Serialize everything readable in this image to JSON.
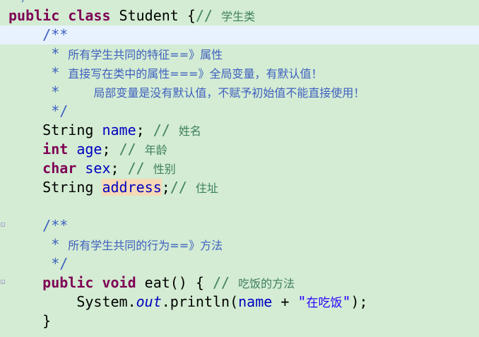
{
  "editor": {
    "lines": [
      {
        "parts": [
          "public",
          " ",
          "class",
          " Student {",
          "// ",
          "学生类"
        ]
      },
      {
        "parts": [
          "    ",
          "/**"
        ]
      },
      {
        "parts": [
          "     * ",
          "所有学生共同的特征==》属性"
        ]
      },
      {
        "parts": [
          "     * ",
          "直接写在类中的属性===》全局变量，有默认值！"
        ]
      },
      {
        "parts": [
          "     *    ",
          "局部变量是没有默认值，不赋予初始值不能直接使用！"
        ]
      },
      {
        "parts": [
          "     */"
        ]
      },
      {
        "parts": [
          "    String ",
          "name",
          "; ",
          "// ",
          "姓名"
        ]
      },
      {
        "parts": [
          "    ",
          "int",
          " ",
          "age",
          "; ",
          "// ",
          "年龄"
        ]
      },
      {
        "parts": [
          "    ",
          "char",
          " ",
          "sex",
          "; ",
          "// ",
          "性别"
        ]
      },
      {
        "parts": [
          "    String ",
          "address",
          ";",
          "// ",
          "住址"
        ]
      },
      {
        "parts": [
          ""
        ]
      },
      {
        "parts": [
          "    ",
          "/**"
        ]
      },
      {
        "parts": [
          "     * ",
          "所有学生共同的行为==》方法"
        ]
      },
      {
        "parts": [
          "     */"
        ]
      },
      {
        "parts": [
          "    ",
          "public",
          " ",
          "void",
          " eat() { ",
          "// ",
          "吃饭的方法"
        ]
      },
      {
        "parts": [
          "        System.",
          "out",
          ".println(",
          "name",
          " + ",
          "\"",
          "在吃饭",
          "\"",
          ");"
        ]
      },
      {
        "parts": [
          "    }"
        ]
      }
    ]
  },
  "colors": {
    "background": "#d3ecd3",
    "current_line": "#e8f2fe",
    "keyword": "#7f0055",
    "comment": "#3f7f5f",
    "javadoc": "#3f5fbf",
    "field": "#0000c0",
    "string": "#2a00ff",
    "occurrence_highlight": "#f6d9b6"
  },
  "icons": {
    "fold_marker": "fold-collapse-icon"
  }
}
